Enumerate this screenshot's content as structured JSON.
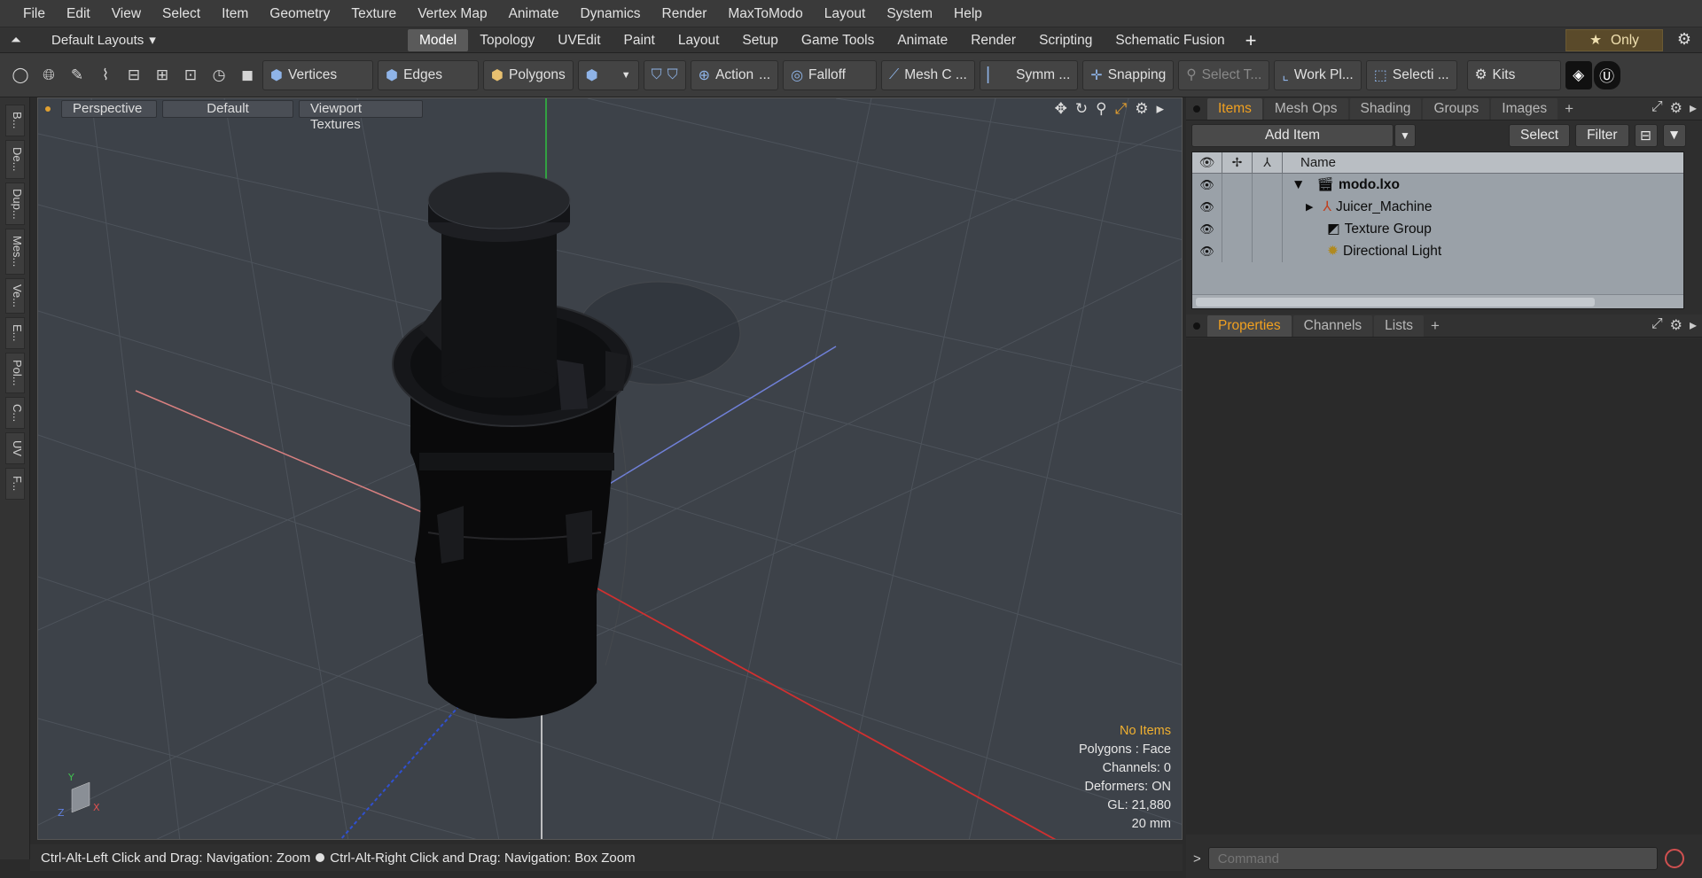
{
  "menubar": {
    "items": [
      "File",
      "Edit",
      "View",
      "Select",
      "Item",
      "Geometry",
      "Texture",
      "Vertex Map",
      "Animate",
      "Dynamics",
      "Render",
      "MaxToModo",
      "Layout",
      "System",
      "Help"
    ]
  },
  "tabbar": {
    "layouts_label": "Default Layouts",
    "tabs": [
      "Model",
      "Topology",
      "UVEdit",
      "Paint",
      "Layout",
      "Setup",
      "Game Tools",
      "Animate",
      "Render",
      "Scripting",
      "Schematic Fusion"
    ],
    "active_tab": "Model",
    "only_label": "Only"
  },
  "toolbar": {
    "vertices": "Vertices",
    "edges": "Edges",
    "polygons": "Polygons",
    "action": "Action",
    "action_more": "...",
    "falloff": "Falloff",
    "mesh": "Mesh C ...",
    "symm": "Symm ...",
    "snapping": "Snapping",
    "select_t": "Select T...",
    "work_pl": "Work Pl...",
    "selecti": "Selecti ...",
    "kits": "Kits"
  },
  "leftstrip": {
    "tabs": [
      "B...",
      "De...",
      "Dup...",
      "Mes...",
      "Ve...",
      "E...",
      "Pol...",
      "C...",
      "UV",
      "F..."
    ]
  },
  "viewport": {
    "view_mode": "Perspective",
    "shading": "Default",
    "textures": "Viewport Textures",
    "info": {
      "selection": "No Items",
      "polygons": "Polygons : Face",
      "channels": "Channels: 0",
      "deformers": "Deformers: ON",
      "gl": "GL: 21,880",
      "units": "20 mm"
    }
  },
  "statusbar": {
    "hint_left": "Ctrl-Alt-Left Click and Drag: Navigation: Zoom",
    "hint_right": "Ctrl-Alt-Right Click and Drag: Navigation: Box Zoom"
  },
  "items_panel": {
    "tabs": [
      "Items",
      "Mesh Ops",
      "Shading",
      "Groups",
      "Images"
    ],
    "active_tab": "Items",
    "add_item": "Add Item",
    "select": "Select",
    "filter": "Filter",
    "column_name": "Name",
    "rows": [
      {
        "name": "modo.lxo",
        "bold": true,
        "expand": "▼"
      },
      {
        "name": "Juicer_Machine",
        "bold": false,
        "expand": "▶"
      },
      {
        "name": "Texture Group",
        "bold": false,
        "expand": ""
      },
      {
        "name": "Directional Light",
        "bold": false,
        "expand": ""
      }
    ]
  },
  "properties_panel": {
    "tabs": [
      "Properties",
      "Channels",
      "Lists"
    ],
    "active_tab": "Properties"
  },
  "command": {
    "placeholder": "Command",
    "prompt": ">"
  },
  "colors": {
    "accent": "#f0a020",
    "viewport_bg": "#3d4249",
    "axis_x": "#d03030",
    "axis_y": "#30c040",
    "axis_z": "#4060d0"
  }
}
